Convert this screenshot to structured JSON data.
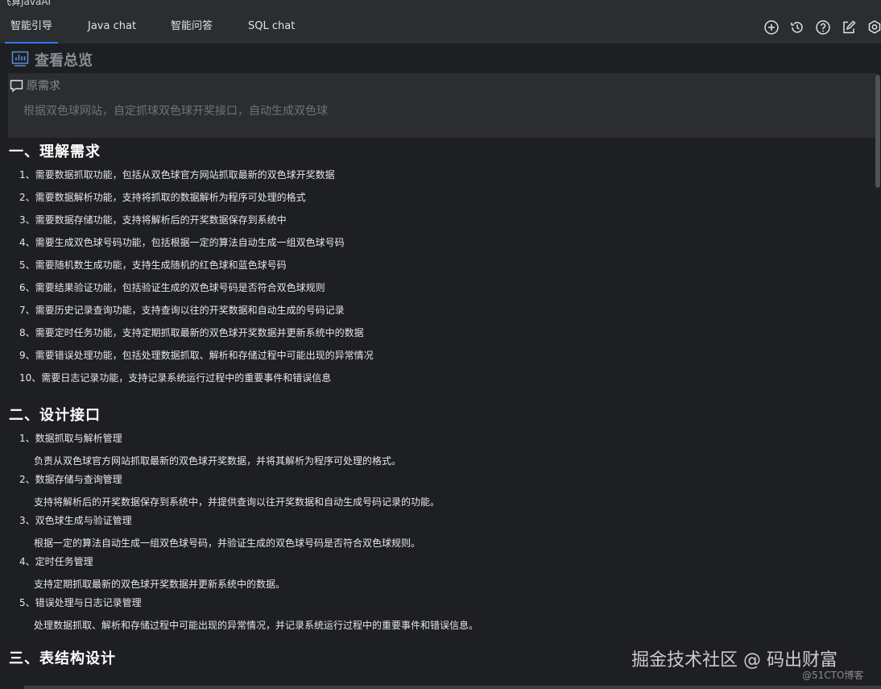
{
  "window": {
    "title": "飞算JavaAI"
  },
  "tabs": [
    {
      "label": "智能引导",
      "active": true
    },
    {
      "label": "Java chat"
    },
    {
      "label": "智能问答"
    },
    {
      "label": "SQL chat"
    }
  ],
  "toolbar_icons": [
    "add-icon",
    "history-icon",
    "help-icon",
    "edit-icon",
    "settings-icon"
  ],
  "overview": {
    "title": "查看总览",
    "icon": "chart-icon"
  },
  "requirement": {
    "label": "原需求",
    "icon": "comment-icon",
    "text": "根据双色球网站，自定抓球双色球开奖接口，自动生成双色球"
  },
  "section1": {
    "heading": "一、理解需求",
    "items": [
      "1、需要数据抓取功能，包括从双色球官方网站抓取最新的双色球开奖数据",
      "2、需要数据解析功能，支持将抓取的数据解析为程序可处理的格式",
      "3、需要数据存储功能，支持将解析后的开奖数据保存到系统中",
      "4、需要生成双色球号码功能，包括根据一定的算法自动生成一组双色球号码",
      "5、需要随机数生成功能，支持生成随机的红色球和蓝色球号码",
      "6、需要结果验证功能，包括验证生成的双色球号码是否符合双色球规则",
      "7、需要历史记录查询功能，支持查询以往的开奖数据和自动生成的号码记录",
      "8、需要定时任务功能，支持定期抓取最新的双色球开奖数据并更新系统中的数据",
      "9、需要错误处理功能，包括处理数据抓取、解析和存储过程中可能出现的异常情况",
      "10、需要日志记录功能，支持记录系统运行过程中的重要事件和错误信息"
    ]
  },
  "section2": {
    "heading": "二、设计接口",
    "items": [
      {
        "title": "1、数据抓取与解析管理",
        "desc": "负责从双色球官方网站抓取最新的双色球开奖数据，并将其解析为程序可处理的格式。"
      },
      {
        "title": "2、数据存储与查询管理",
        "desc": "支持将解析后的开奖数据保存到系统中，并提供查询以往开奖数据和自动生成号码记录的功能。"
      },
      {
        "title": "3、双色球生成与验证管理",
        "desc": "根据一定的算法自动生成一组双色球号码，并验证生成的双色球号码是否符合双色球规则。"
      },
      {
        "title": "4、定时任务管理",
        "desc": "支持定期抓取最新的双色球开奖数据并更新系统中的数据。"
      },
      {
        "title": "5、错误处理与日志记录管理",
        "desc": "处理数据抓取、解析和存储过程中可能出现的异常情况，并记录系统运行过程中的重要事件和错误信息。"
      }
    ]
  },
  "section3": {
    "heading": "三、表结构设计"
  },
  "watermark": {
    "main": "掘金技术社区 @ 码出财富",
    "sub": "@51CTO博客"
  }
}
